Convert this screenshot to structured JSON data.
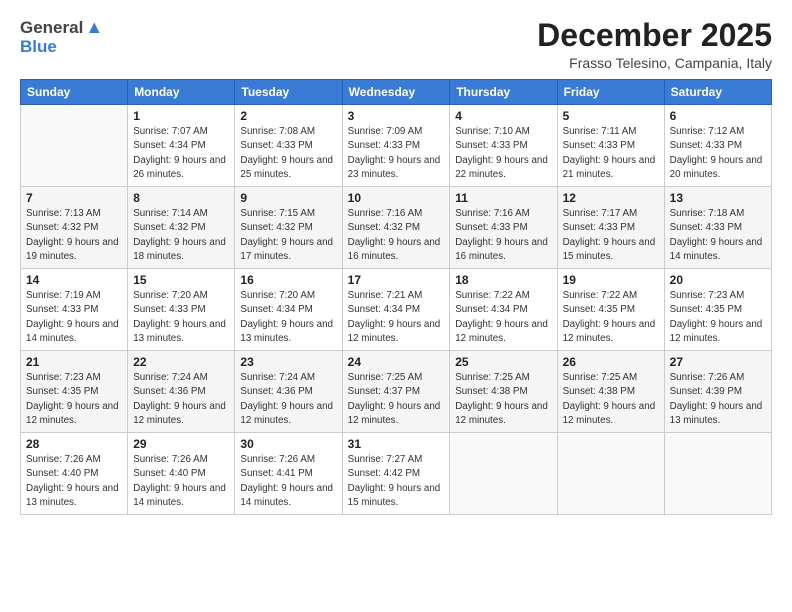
{
  "logo": {
    "general": "General",
    "blue": "Blue"
  },
  "header": {
    "title": "December 2025",
    "location": "Frasso Telesino, Campania, Italy"
  },
  "weekdays": [
    "Sunday",
    "Monday",
    "Tuesday",
    "Wednesday",
    "Thursday",
    "Friday",
    "Saturday"
  ],
  "weeks": [
    [
      {
        "day": "",
        "sunrise": "",
        "sunset": "",
        "daylight": ""
      },
      {
        "day": "1",
        "sunrise": "Sunrise: 7:07 AM",
        "sunset": "Sunset: 4:34 PM",
        "daylight": "Daylight: 9 hours and 26 minutes."
      },
      {
        "day": "2",
        "sunrise": "Sunrise: 7:08 AM",
        "sunset": "Sunset: 4:33 PM",
        "daylight": "Daylight: 9 hours and 25 minutes."
      },
      {
        "day": "3",
        "sunrise": "Sunrise: 7:09 AM",
        "sunset": "Sunset: 4:33 PM",
        "daylight": "Daylight: 9 hours and 23 minutes."
      },
      {
        "day": "4",
        "sunrise": "Sunrise: 7:10 AM",
        "sunset": "Sunset: 4:33 PM",
        "daylight": "Daylight: 9 hours and 22 minutes."
      },
      {
        "day": "5",
        "sunrise": "Sunrise: 7:11 AM",
        "sunset": "Sunset: 4:33 PM",
        "daylight": "Daylight: 9 hours and 21 minutes."
      },
      {
        "day": "6",
        "sunrise": "Sunrise: 7:12 AM",
        "sunset": "Sunset: 4:33 PM",
        "daylight": "Daylight: 9 hours and 20 minutes."
      }
    ],
    [
      {
        "day": "7",
        "sunrise": "Sunrise: 7:13 AM",
        "sunset": "Sunset: 4:32 PM",
        "daylight": "Daylight: 9 hours and 19 minutes."
      },
      {
        "day": "8",
        "sunrise": "Sunrise: 7:14 AM",
        "sunset": "Sunset: 4:32 PM",
        "daylight": "Daylight: 9 hours and 18 minutes."
      },
      {
        "day": "9",
        "sunrise": "Sunrise: 7:15 AM",
        "sunset": "Sunset: 4:32 PM",
        "daylight": "Daylight: 9 hours and 17 minutes."
      },
      {
        "day": "10",
        "sunrise": "Sunrise: 7:16 AM",
        "sunset": "Sunset: 4:32 PM",
        "daylight": "Daylight: 9 hours and 16 minutes."
      },
      {
        "day": "11",
        "sunrise": "Sunrise: 7:16 AM",
        "sunset": "Sunset: 4:33 PM",
        "daylight": "Daylight: 9 hours and 16 minutes."
      },
      {
        "day": "12",
        "sunrise": "Sunrise: 7:17 AM",
        "sunset": "Sunset: 4:33 PM",
        "daylight": "Daylight: 9 hours and 15 minutes."
      },
      {
        "day": "13",
        "sunrise": "Sunrise: 7:18 AM",
        "sunset": "Sunset: 4:33 PM",
        "daylight": "Daylight: 9 hours and 14 minutes."
      }
    ],
    [
      {
        "day": "14",
        "sunrise": "Sunrise: 7:19 AM",
        "sunset": "Sunset: 4:33 PM",
        "daylight": "Daylight: 9 hours and 14 minutes."
      },
      {
        "day": "15",
        "sunrise": "Sunrise: 7:20 AM",
        "sunset": "Sunset: 4:33 PM",
        "daylight": "Daylight: 9 hours and 13 minutes."
      },
      {
        "day": "16",
        "sunrise": "Sunrise: 7:20 AM",
        "sunset": "Sunset: 4:34 PM",
        "daylight": "Daylight: 9 hours and 13 minutes."
      },
      {
        "day": "17",
        "sunrise": "Sunrise: 7:21 AM",
        "sunset": "Sunset: 4:34 PM",
        "daylight": "Daylight: 9 hours and 12 minutes."
      },
      {
        "day": "18",
        "sunrise": "Sunrise: 7:22 AM",
        "sunset": "Sunset: 4:34 PM",
        "daylight": "Daylight: 9 hours and 12 minutes."
      },
      {
        "day": "19",
        "sunrise": "Sunrise: 7:22 AM",
        "sunset": "Sunset: 4:35 PM",
        "daylight": "Daylight: 9 hours and 12 minutes."
      },
      {
        "day": "20",
        "sunrise": "Sunrise: 7:23 AM",
        "sunset": "Sunset: 4:35 PM",
        "daylight": "Daylight: 9 hours and 12 minutes."
      }
    ],
    [
      {
        "day": "21",
        "sunrise": "Sunrise: 7:23 AM",
        "sunset": "Sunset: 4:35 PM",
        "daylight": "Daylight: 9 hours and 12 minutes."
      },
      {
        "day": "22",
        "sunrise": "Sunrise: 7:24 AM",
        "sunset": "Sunset: 4:36 PM",
        "daylight": "Daylight: 9 hours and 12 minutes."
      },
      {
        "day": "23",
        "sunrise": "Sunrise: 7:24 AM",
        "sunset": "Sunset: 4:36 PM",
        "daylight": "Daylight: 9 hours and 12 minutes."
      },
      {
        "day": "24",
        "sunrise": "Sunrise: 7:25 AM",
        "sunset": "Sunset: 4:37 PM",
        "daylight": "Daylight: 9 hours and 12 minutes."
      },
      {
        "day": "25",
        "sunrise": "Sunrise: 7:25 AM",
        "sunset": "Sunset: 4:38 PM",
        "daylight": "Daylight: 9 hours and 12 minutes."
      },
      {
        "day": "26",
        "sunrise": "Sunrise: 7:25 AM",
        "sunset": "Sunset: 4:38 PM",
        "daylight": "Daylight: 9 hours and 12 minutes."
      },
      {
        "day": "27",
        "sunrise": "Sunrise: 7:26 AM",
        "sunset": "Sunset: 4:39 PM",
        "daylight": "Daylight: 9 hours and 13 minutes."
      }
    ],
    [
      {
        "day": "28",
        "sunrise": "Sunrise: 7:26 AM",
        "sunset": "Sunset: 4:40 PM",
        "daylight": "Daylight: 9 hours and 13 minutes."
      },
      {
        "day": "29",
        "sunrise": "Sunrise: 7:26 AM",
        "sunset": "Sunset: 4:40 PM",
        "daylight": "Daylight: 9 hours and 14 minutes."
      },
      {
        "day": "30",
        "sunrise": "Sunrise: 7:26 AM",
        "sunset": "Sunset: 4:41 PM",
        "daylight": "Daylight: 9 hours and 14 minutes."
      },
      {
        "day": "31",
        "sunrise": "Sunrise: 7:27 AM",
        "sunset": "Sunset: 4:42 PM",
        "daylight": "Daylight: 9 hours and 15 minutes."
      },
      {
        "day": "",
        "sunrise": "",
        "sunset": "",
        "daylight": ""
      },
      {
        "day": "",
        "sunrise": "",
        "sunset": "",
        "daylight": ""
      },
      {
        "day": "",
        "sunrise": "",
        "sunset": "",
        "daylight": ""
      }
    ]
  ]
}
